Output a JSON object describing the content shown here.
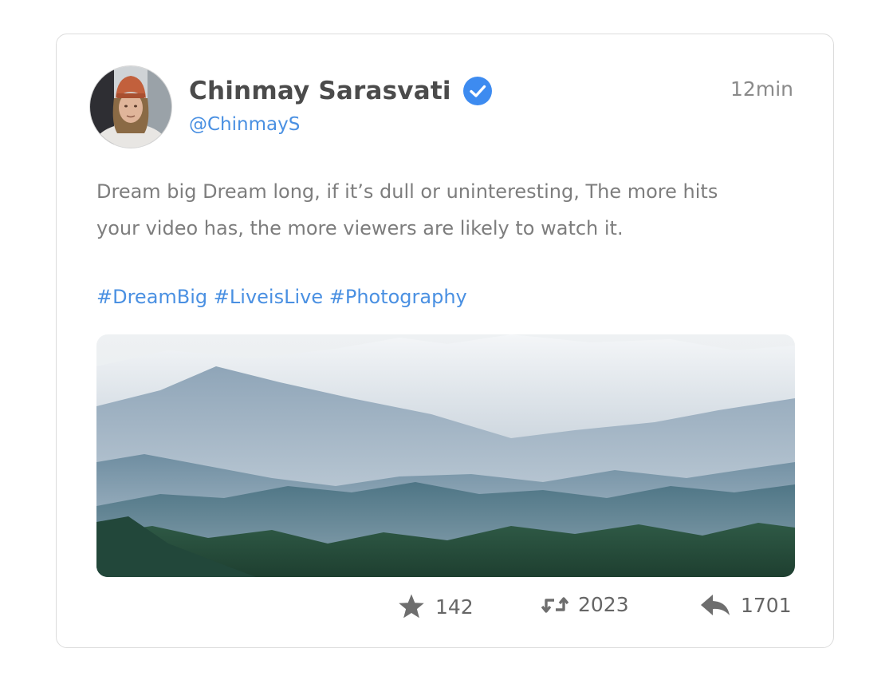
{
  "post": {
    "author_name": "Chinmay Sarasvati",
    "handle": "@ChinmayS",
    "time": "12min",
    "verified": true,
    "body_text": "Dream big Dream long, if it’s dull or uninteresting, The more hits your video has, the more viewers are likely to watch it.",
    "hashtags": [
      "#DreamBig",
      "#LiveisLive",
      "#Photography"
    ]
  },
  "actions": {
    "likes": "142",
    "retweets": "2023",
    "replies": "1701"
  },
  "icons": {
    "verified": "verified-check-icon",
    "like": "star-icon",
    "retweet": "retweet-icon",
    "reply": "reply-arrow-icon"
  },
  "colors": {
    "accent": "#4a90e2",
    "verified_badge": "#3d8bf0",
    "name": "#4b4b4b",
    "body_text": "#7d7d7d",
    "meta": "#8a8a8a"
  }
}
